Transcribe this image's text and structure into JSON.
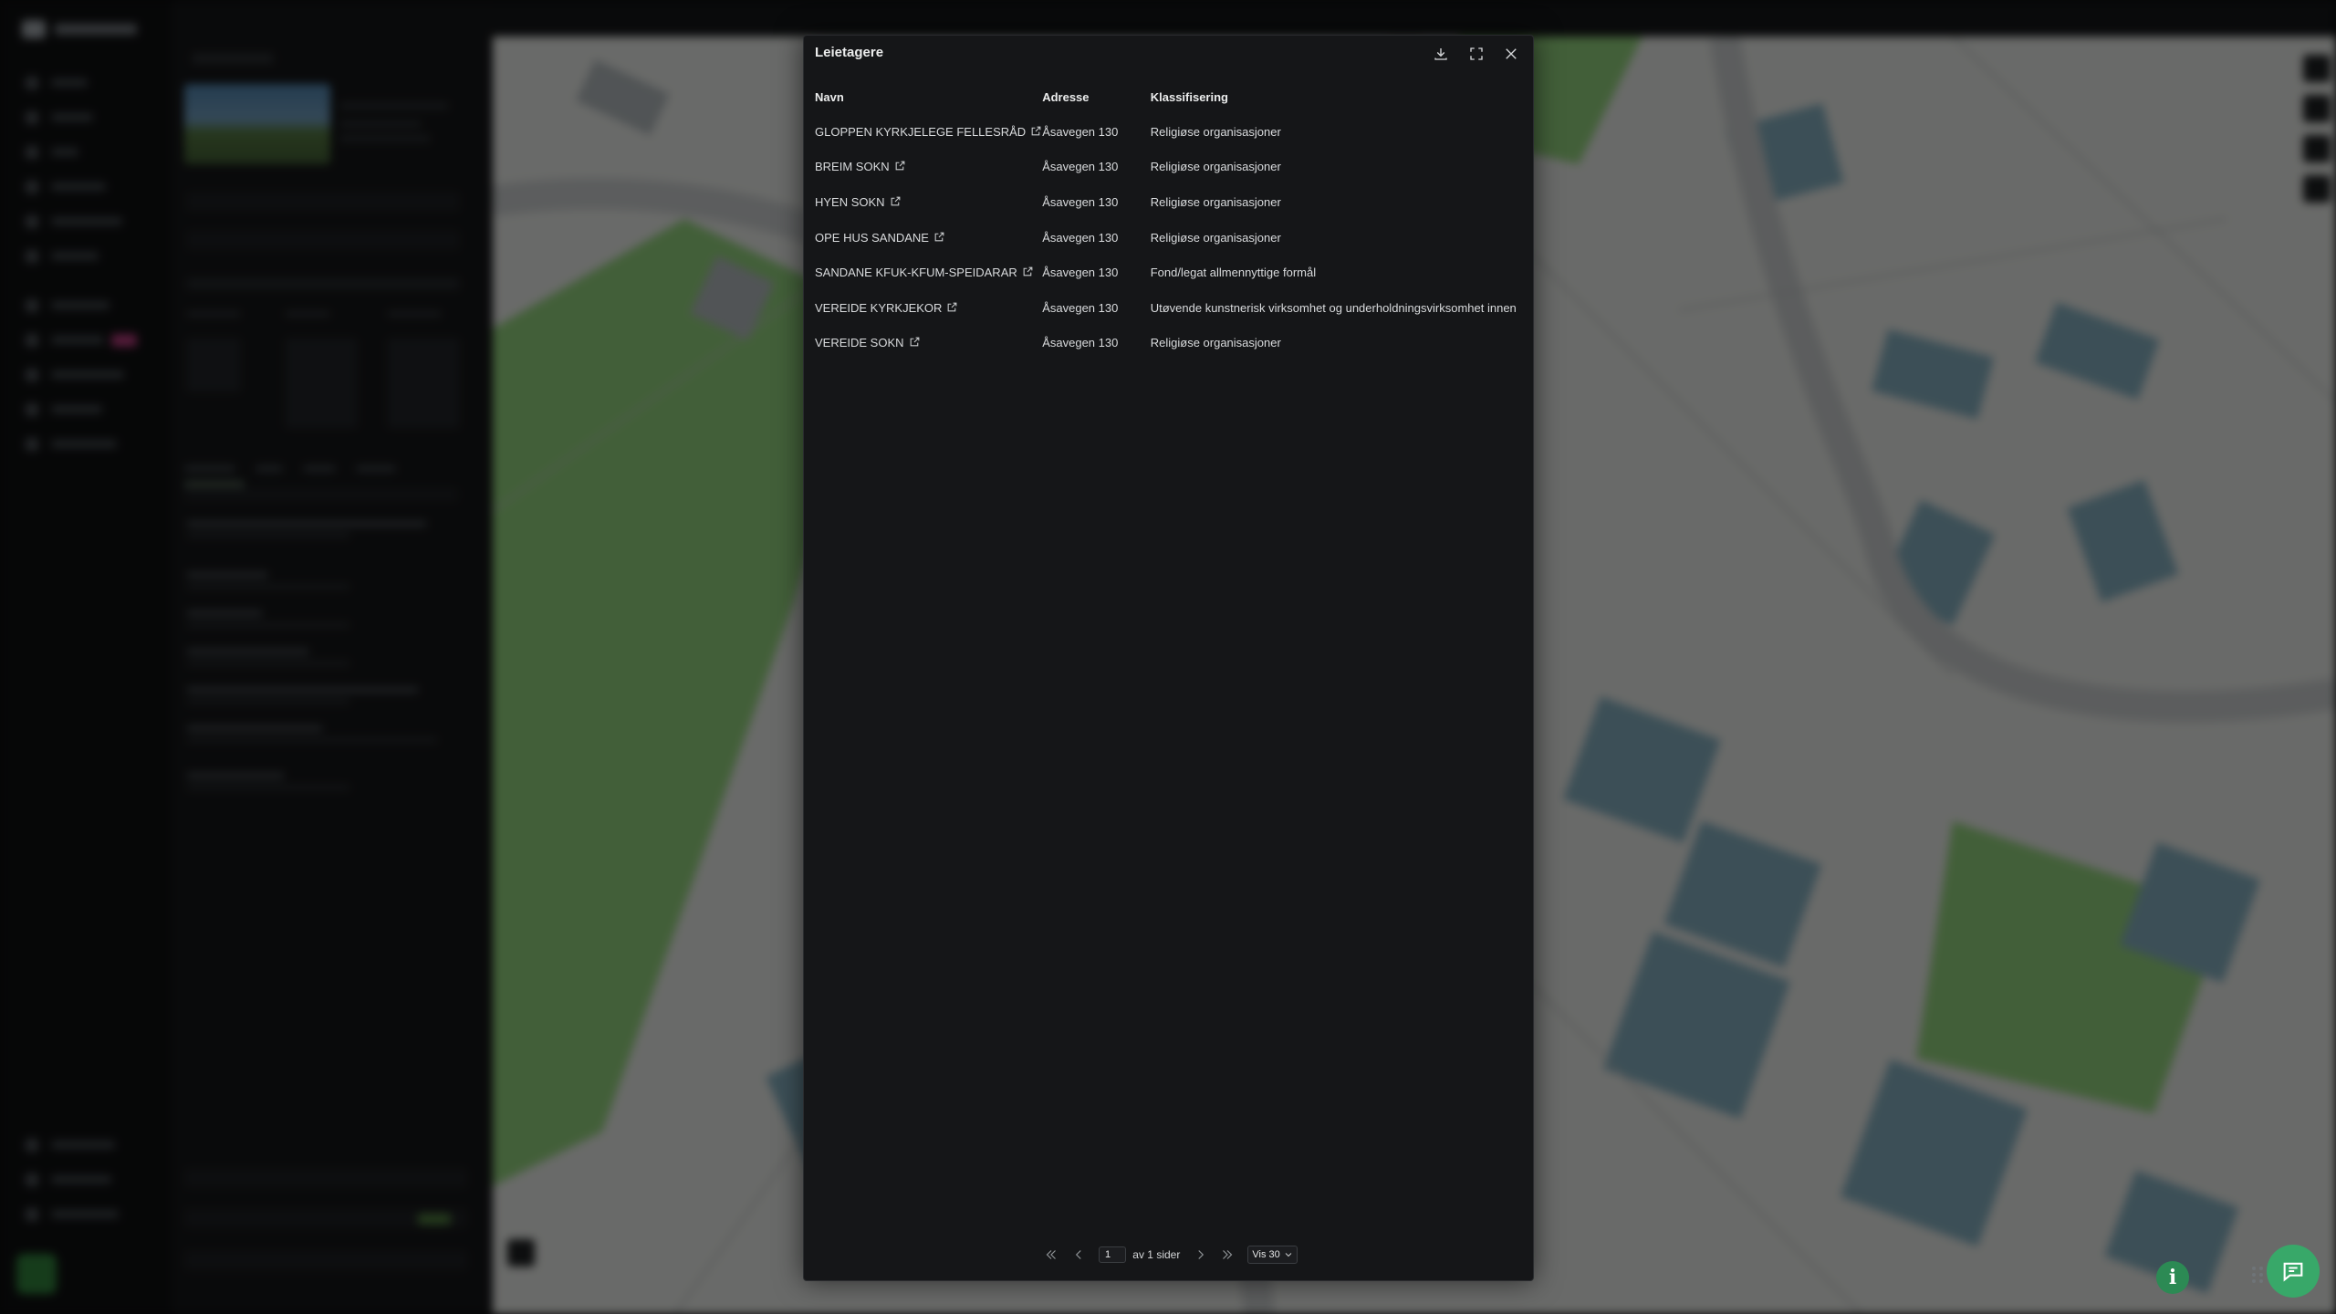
{
  "modal": {
    "title": "Leietagere",
    "actions": {
      "download_icon": "download-icon",
      "fullscreen_icon": "expand-icon",
      "close_icon": "close-icon"
    },
    "columns": [
      "Navn",
      "Adresse",
      "Klassifisering"
    ],
    "rows": [
      {
        "name": "GLOPPEN KYRKJELEGE FELLESRÅD",
        "address": "Åsavegen 130",
        "classification": "Religiøse organisasjoner"
      },
      {
        "name": "BREIM SOKN",
        "address": "Åsavegen 130",
        "classification": "Religiøse organisasjoner"
      },
      {
        "name": "HYEN SOKN",
        "address": "Åsavegen 130",
        "classification": "Religiøse organisasjoner"
      },
      {
        "name": "OPE HUS SANDANE",
        "address": "Åsavegen 130",
        "classification": "Religiøse organisasjoner"
      },
      {
        "name": "SANDANE KFUK-KFUM-SPEIDARAR",
        "address": "Åsavegen 130",
        "classification": "Fond/legat allmennyttige formål"
      },
      {
        "name": "VEREIDE KYRKJEKOR",
        "address": "Åsavegen 130",
        "classification": "Utøvende kunstnerisk virksomhet og underholdningsvirksomhet innen"
      },
      {
        "name": "VEREIDE SOKN",
        "address": "Åsavegen 130",
        "classification": "Religiøse organisasjoner"
      }
    ],
    "pagination": {
      "page": "1",
      "of_text": "av 1 sider",
      "page_size": "Vis 30"
    }
  },
  "colors": {
    "modal_bg": "#151618",
    "accent_green": "#38a869",
    "text": "#d9dbdd"
  }
}
